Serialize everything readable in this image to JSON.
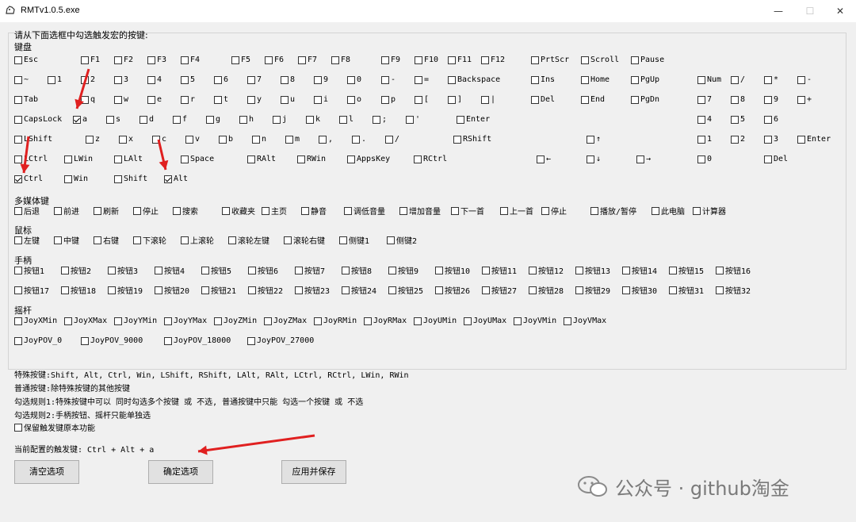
{
  "window": {
    "title": "RMTv1.0.5.exe",
    "minimize": "—",
    "maximize": "☐",
    "close": "✕"
  },
  "instruction": "请从下面选框中勾选触发宏的按键:",
  "sections": {
    "keyboard": "键盘",
    "media": "多媒体键",
    "mouse": "鼠标",
    "gamepad": "手柄",
    "joystick": "摇杆"
  },
  "rows": [
    [
      [
        "Esc",
        0
      ],
      [
        "F1",
        0
      ],
      [
        "F2",
        0
      ],
      [
        "F3",
        0
      ],
      [
        "F4",
        0
      ],
      [
        "F5",
        0
      ],
      [
        "F6",
        0
      ],
      [
        "F7",
        0
      ],
      [
        "F8",
        0
      ],
      [
        "F9",
        0
      ],
      [
        "F10",
        0
      ],
      [
        "F11",
        0
      ],
      [
        "F12",
        0
      ],
      [
        "PrtScr",
        0
      ],
      [
        "Scroll",
        0
      ],
      [
        "Pause",
        0
      ]
    ],
    [
      [
        "~",
        0
      ],
      [
        "1",
        0
      ],
      [
        "2",
        0
      ],
      [
        "3",
        0
      ],
      [
        "4",
        0
      ],
      [
        "5",
        0
      ],
      [
        "6",
        0
      ],
      [
        "7",
        0
      ],
      [
        "8",
        0
      ],
      [
        "9",
        0
      ],
      [
        "0",
        0
      ],
      [
        "-",
        0
      ],
      [
        "=",
        0
      ],
      [
        "Backspace",
        0
      ],
      [
        "Ins",
        0
      ],
      [
        "Home",
        0
      ],
      [
        "PgUp",
        0
      ],
      [
        "Num",
        0
      ],
      [
        "/",
        0
      ],
      [
        "*",
        0
      ],
      [
        "-",
        0
      ]
    ],
    [
      [
        "Tab",
        0
      ],
      [
        "q",
        0
      ],
      [
        "w",
        0
      ],
      [
        "e",
        0
      ],
      [
        "r",
        0
      ],
      [
        "t",
        0
      ],
      [
        "y",
        0
      ],
      [
        "u",
        0
      ],
      [
        "i",
        0
      ],
      [
        "o",
        0
      ],
      [
        "p",
        0
      ],
      [
        "[",
        0
      ],
      [
        "]",
        0
      ],
      [
        "|",
        0
      ],
      [
        "Del",
        0
      ],
      [
        "End",
        0
      ],
      [
        "PgDn",
        0
      ],
      [
        "7",
        0
      ],
      [
        "8",
        0
      ],
      [
        "9",
        0
      ],
      [
        "+",
        0
      ]
    ],
    [
      [
        "CapsLock",
        0
      ],
      [
        "a",
        1
      ],
      [
        "s",
        0
      ],
      [
        "d",
        0
      ],
      [
        "f",
        0
      ],
      [
        "g",
        0
      ],
      [
        "h",
        0
      ],
      [
        "j",
        0
      ],
      [
        "k",
        0
      ],
      [
        "l",
        0
      ],
      [
        ";",
        0
      ],
      [
        "'",
        0
      ],
      [
        "Enter",
        0
      ],
      [
        "4",
        0
      ],
      [
        "5",
        0
      ],
      [
        "6",
        0
      ]
    ],
    [
      [
        "LShift",
        0
      ],
      [
        "z",
        0
      ],
      [
        "x",
        0
      ],
      [
        "c",
        0
      ],
      [
        "v",
        0
      ],
      [
        "b",
        0
      ],
      [
        "n",
        0
      ],
      [
        "m",
        0
      ],
      [
        ",",
        0
      ],
      [
        ".",
        0
      ],
      [
        "/",
        0
      ],
      [
        "RShift",
        0
      ],
      [
        "↑",
        0
      ],
      [
        "1",
        0
      ],
      [
        "2",
        0
      ],
      [
        "3",
        0
      ],
      [
        "Enter",
        0
      ]
    ],
    [
      [
        "LCtrl",
        0
      ],
      [
        "LWin",
        0
      ],
      [
        "LAlt",
        0
      ],
      [
        "Space",
        0
      ],
      [
        "RAlt",
        0
      ],
      [
        "RWin",
        0
      ],
      [
        "AppsKey",
        0
      ],
      [
        "RCtrl",
        0
      ],
      [
        "←",
        0
      ],
      [
        "↓",
        0
      ],
      [
        "→",
        0
      ],
      [
        "0",
        0
      ],
      [
        "Del",
        0
      ]
    ],
    [
      [
        "Ctrl",
        1
      ],
      [
        "Win",
        0
      ],
      [
        "Shift",
        0
      ],
      [
        "Alt",
        1
      ]
    ],
    [
      [
        "后退",
        0
      ],
      [
        "前进",
        0
      ],
      [
        "刷新",
        0
      ],
      [
        "停止",
        0
      ],
      [
        "搜索",
        0
      ],
      [
        "收藏夹",
        0
      ],
      [
        "主页",
        0
      ],
      [
        "静音",
        0
      ],
      [
        "调低音量",
        0
      ],
      [
        "增加音量",
        0
      ],
      [
        "下一首",
        0
      ],
      [
        "上一首",
        0
      ],
      [
        "停止",
        0
      ],
      [
        "播放/暂停",
        0
      ],
      [
        "此电脑",
        0
      ],
      [
        "计算器",
        0
      ]
    ],
    [
      [
        "左键",
        0
      ],
      [
        "中键",
        0
      ],
      [
        "右键",
        0
      ],
      [
        "下滚轮",
        0
      ],
      [
        "上滚轮",
        0
      ],
      [
        "滚轮左键",
        0
      ],
      [
        "滚轮右键",
        0
      ],
      [
        "侧键1",
        0
      ],
      [
        "侧键2",
        0
      ]
    ],
    [
      [
        "按钮1",
        0
      ],
      [
        "按钮2",
        0
      ],
      [
        "按钮3",
        0
      ],
      [
        "按钮4",
        0
      ],
      [
        "按钮5",
        0
      ],
      [
        "按钮6",
        0
      ],
      [
        "按钮7",
        0
      ],
      [
        "按钮8",
        0
      ],
      [
        "按钮9",
        0
      ],
      [
        "按钮10",
        0
      ],
      [
        "按钮11",
        0
      ],
      [
        "按钮12",
        0
      ],
      [
        "按钮13",
        0
      ],
      [
        "按钮14",
        0
      ],
      [
        "按钮15",
        0
      ],
      [
        "按钮16",
        0
      ]
    ],
    [
      [
        "按钮17",
        0
      ],
      [
        "按钮18",
        0
      ],
      [
        "按钮19",
        0
      ],
      [
        "按钮20",
        0
      ],
      [
        "按钮21",
        0
      ],
      [
        "按钮22",
        0
      ],
      [
        "按钮23",
        0
      ],
      [
        "按钮24",
        0
      ],
      [
        "按钮25",
        0
      ],
      [
        "按钮26",
        0
      ],
      [
        "按钮27",
        0
      ],
      [
        "按钮28",
        0
      ],
      [
        "按钮29",
        0
      ],
      [
        "按钮30",
        0
      ],
      [
        "按钮31",
        0
      ],
      [
        "按钮32",
        0
      ]
    ],
    [
      [
        "JoyXMin",
        0
      ],
      [
        "JoyXMax",
        0
      ],
      [
        "JoyYMin",
        0
      ],
      [
        "JoyYMax",
        0
      ],
      [
        "JoyZMin",
        0
      ],
      [
        "JoyZMax",
        0
      ],
      [
        "JoyRMin",
        0
      ],
      [
        "JoyRMax",
        0
      ],
      [
        "JoyUMin",
        0
      ],
      [
        "JoyUMax",
        0
      ],
      [
        "JoyVMin",
        0
      ],
      [
        "JoyVMax",
        0
      ]
    ],
    [
      [
        "JoyPOV_0",
        0
      ],
      [
        "JoyPOV_9000",
        0
      ],
      [
        "JoyPOV_18000",
        0
      ],
      [
        "JoyPOV_27000",
        0
      ]
    ]
  ],
  "info": {
    "special": "特殊按键:Shift, Alt, Ctrl, Win, LShift, RShift, LAlt, RAlt, LCtrl, RCtrl, LWin, RWin",
    "normal": "普通按键:除特殊按键的其他按键",
    "rule1": "勾选规则1:特殊按键中可以 同时勾选多个按键 或 不选, 普通按键中只能 勾选一个按键 或 不选",
    "rule2": "勾选规则2:手柄按钮、摇杆只能单独选",
    "keep_label": "保留触发键原本功能",
    "current": "当前配置的触发键: Ctrl  +  Alt  +  a"
  },
  "buttons": {
    "clear": "清空选项",
    "confirm": "确定选项",
    "apply_save": "应用并保存"
  },
  "watermark": "公众号 · github淘金",
  "annotation_color": "#e02020"
}
